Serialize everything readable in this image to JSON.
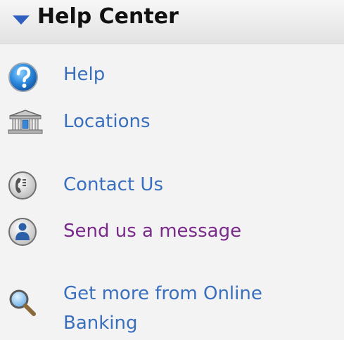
{
  "header": {
    "title": "Help Center",
    "toggle_icon": "triangle-down-icon",
    "accent_color": "#2f5fbf"
  },
  "menu": {
    "items": [
      {
        "label": "Help",
        "icon": "question-icon"
      },
      {
        "label": "Locations",
        "icon": "bank-building-icon"
      },
      {
        "label": "Contact Us",
        "icon": "phone-icon"
      },
      {
        "label": "Send us a message",
        "icon": "person-icon",
        "visited": true
      },
      {
        "label": "Get more from Online Banking",
        "icon": "magnifier-icon"
      }
    ],
    "link_color": "#3a6fbe",
    "visited_link_color": "#7a2a8a"
  }
}
